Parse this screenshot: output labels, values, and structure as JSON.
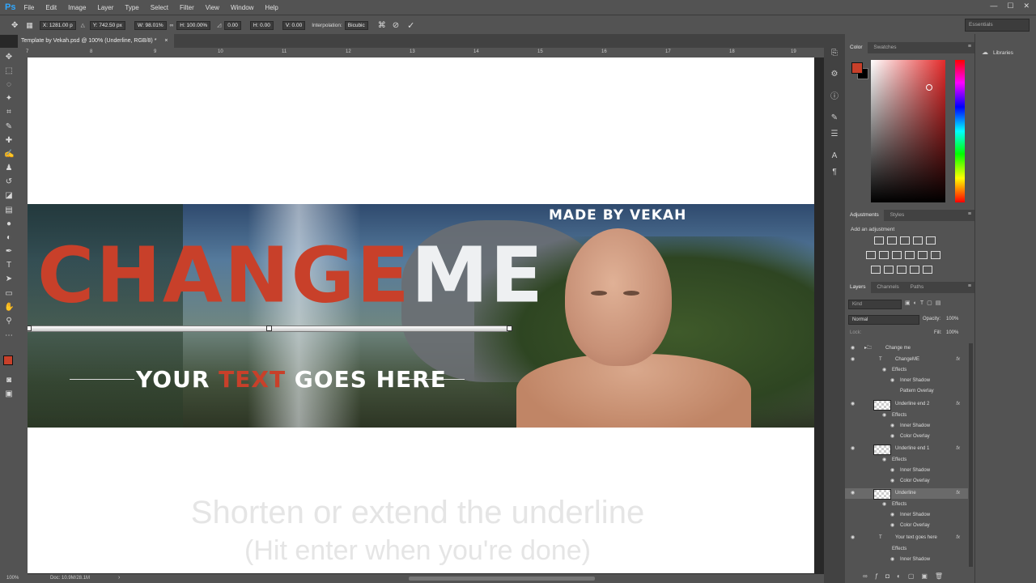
{
  "app": {
    "logo": "Ps",
    "menus": [
      "File",
      "Edit",
      "Image",
      "Layer",
      "Type",
      "Select",
      "Filter",
      "View",
      "Window",
      "Help"
    ],
    "window_controls": [
      "—",
      "☐",
      "✕"
    ],
    "accent": "#31a8ff"
  },
  "options": {
    "x": "X: 1281.00 p",
    "y": "Y: 742.50 px",
    "w": "W: 98.01%",
    "h": "H: 100.00%",
    "angle": "0.00",
    "hskew": "H: 0.00",
    "vskew": "V: 0.00",
    "interp_label": "Interpolation:",
    "interp_value": "Bicubic",
    "workspace": "Essentials"
  },
  "doc_tab": {
    "title": "Template by Vekah.psd @ 100% (Underline, RGB/8) *",
    "close": "×"
  },
  "ruler": [
    "7",
    "8",
    "9",
    "10",
    "11",
    "12",
    "13",
    "14",
    "15",
    "16",
    "17",
    "18",
    "19"
  ],
  "banner": {
    "made_by": "MADE BY VEKAH",
    "title_part1": "CHANGE",
    "title_part2": "ME",
    "subtitle_part1": "YOUR ",
    "subtitle_part2": "TEXT",
    "subtitle_part3": " GOES HERE",
    "accent_red": "#c8402a"
  },
  "hint": {
    "line1": "Shorten or extend the underline",
    "line2": "(Hit enter when you're done)"
  },
  "status": {
    "zoom": "100%",
    "doc": "Doc: 10.9M/28.1M"
  },
  "color_panel": {
    "tab1": "Color",
    "tab2": "Swatches",
    "fg": "#c8402a"
  },
  "adjustments_panel": {
    "tab1": "Adjustments",
    "tab2": "Styles",
    "add_label": "Add an adjustment"
  },
  "layers_panel": {
    "tab1": "Layers",
    "tab2": "Channels",
    "tab3": "Paths",
    "kind": "Kind",
    "blend": "Normal",
    "opacity_label": "Opacity:",
    "opacity": "100%",
    "lock_label": "Lock:",
    "fill_label": "Fill:",
    "fill": "100%",
    "rows": [
      {
        "name": "Change me",
        "type": "group"
      },
      {
        "name": "ChangeME",
        "type": "text",
        "fx": true
      },
      {
        "name": "Effects",
        "type": "effects"
      },
      {
        "name": "Inner Shadow",
        "type": "effect"
      },
      {
        "name": "Pattern Overlay",
        "type": "effect"
      },
      {
        "name": "Underline end 2",
        "type": "pixel",
        "fx": true
      },
      {
        "name": "Effects",
        "type": "effects"
      },
      {
        "name": "Inner Shadow",
        "type": "effect"
      },
      {
        "name": "Color Overlay",
        "type": "effect"
      },
      {
        "name": "Underline end 1",
        "type": "pixel",
        "fx": true
      },
      {
        "name": "Effects",
        "type": "effects"
      },
      {
        "name": "Inner Shadow",
        "type": "effect"
      },
      {
        "name": "Color Overlay",
        "type": "effect"
      },
      {
        "name": "Underline",
        "type": "pixel",
        "fx": true,
        "selected": true
      },
      {
        "name": "Effects",
        "type": "effects"
      },
      {
        "name": "Inner Shadow",
        "type": "effect"
      },
      {
        "name": "Color Overlay",
        "type": "effect"
      },
      {
        "name": "Your text goes here",
        "type": "text",
        "fx": true
      },
      {
        "name": "Effects",
        "type": "effects"
      },
      {
        "name": "Inner Shadow",
        "type": "effect"
      }
    ]
  },
  "libraries": {
    "label": "Libraries"
  }
}
